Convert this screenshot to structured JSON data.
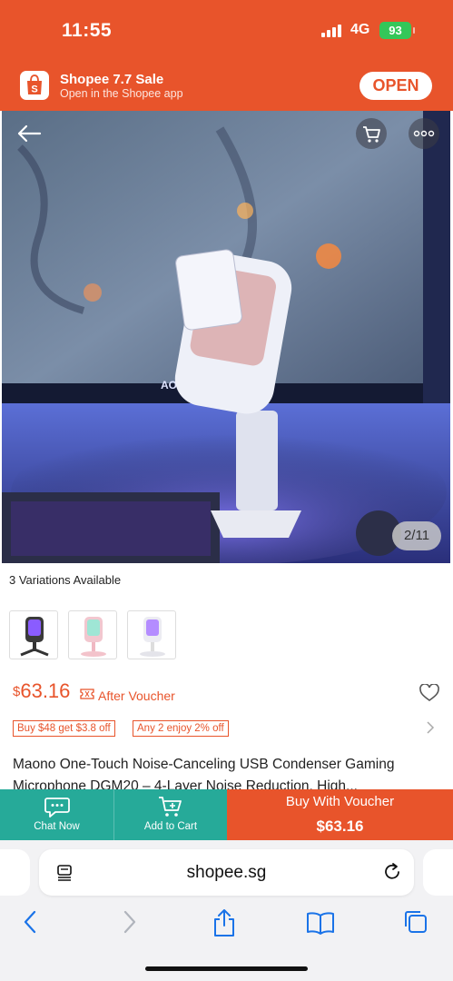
{
  "status_bar": {
    "time": "11:55",
    "network": "4G",
    "battery": "93"
  },
  "banner": {
    "title": "Shopee 7.7 Sale",
    "subtitle": "Open in the Shopee app",
    "open_label": "OPEN",
    "logo_letter": "S"
  },
  "product": {
    "image_counter": "2/11",
    "variations_text": "3 Variations Available",
    "currency": "$",
    "price": "63.16",
    "after_voucher": "After Voucher",
    "tags": [
      "Buy $48 get $3.8 off",
      "Any 2 enjoy 2% off"
    ],
    "title": "Maono One-Touch Noise-Canceling USB Condenser Gaming Microphone DGM20 – 4-Layer Noise Reduction, High..."
  },
  "actions": {
    "chat_now": "Chat Now",
    "add_to_cart": "Add to Cart",
    "buy_with_voucher": "Buy With Voucher",
    "buy_price": "$63.16"
  },
  "browser": {
    "url": "shopee.sg"
  },
  "colors": {
    "brand": "#e8542b",
    "teal": "#26aa99"
  },
  "icons": [
    "back-arrow-icon",
    "cart-icon",
    "more-icon",
    "heart-icon",
    "chat-icon",
    "add-cart-icon",
    "reload-icon",
    "share-icon",
    "bookmarks-icon",
    "tabs-icon"
  ]
}
